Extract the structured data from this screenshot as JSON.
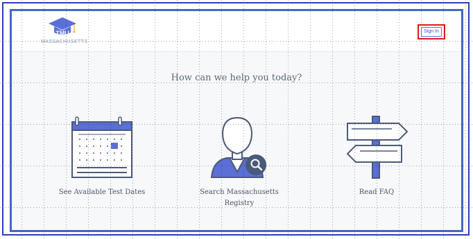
{
  "header": {
    "logo_abbrev": "TMU",
    "logo_state": "MASSACHUSETTS",
    "sign_in_label": "Sign In"
  },
  "main": {
    "heading": "How can we help you today?",
    "cards": [
      {
        "label": "See Available Test Dates",
        "icon": "calendar-icon"
      },
      {
        "label_line1": "Search Massachusetts",
        "label_line2": "Registry",
        "icon": "person-search-icon"
      },
      {
        "label": "Read FAQ",
        "icon": "signpost-icon"
      }
    ]
  },
  "colors": {
    "accent": "#5b6fd6",
    "frame": "#4466c6",
    "highlight": "#d61d1d",
    "icon_stroke": "#4b5a78"
  }
}
